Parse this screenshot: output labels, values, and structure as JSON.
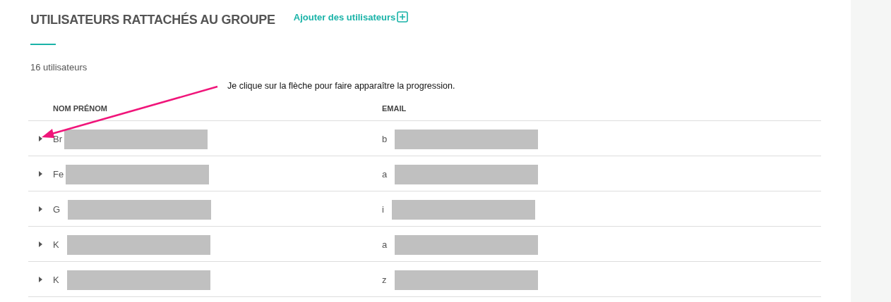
{
  "title": "UTILISATEURS RATTACHÉS AU GROUPE",
  "add_link": {
    "label": "Ajouter des utilisateurs"
  },
  "count": "16 utilisateurs",
  "annotation": "Je clique sur la flèche pour faire apparaître la progression.",
  "table": {
    "columns": [
      "NOM PRÉNOM",
      "EMAIL"
    ],
    "rows": [
      {
        "name": "Br",
        "email": "b",
        "expanded": false
      },
      {
        "name": "Fe",
        "email": "a",
        "expanded": false
      },
      {
        "name": "G",
        "email": "i",
        "expanded": false
      },
      {
        "name": "K",
        "email": "a",
        "expanded": false
      },
      {
        "name": "K",
        "email": "z",
        "expanded": false
      }
    ]
  }
}
